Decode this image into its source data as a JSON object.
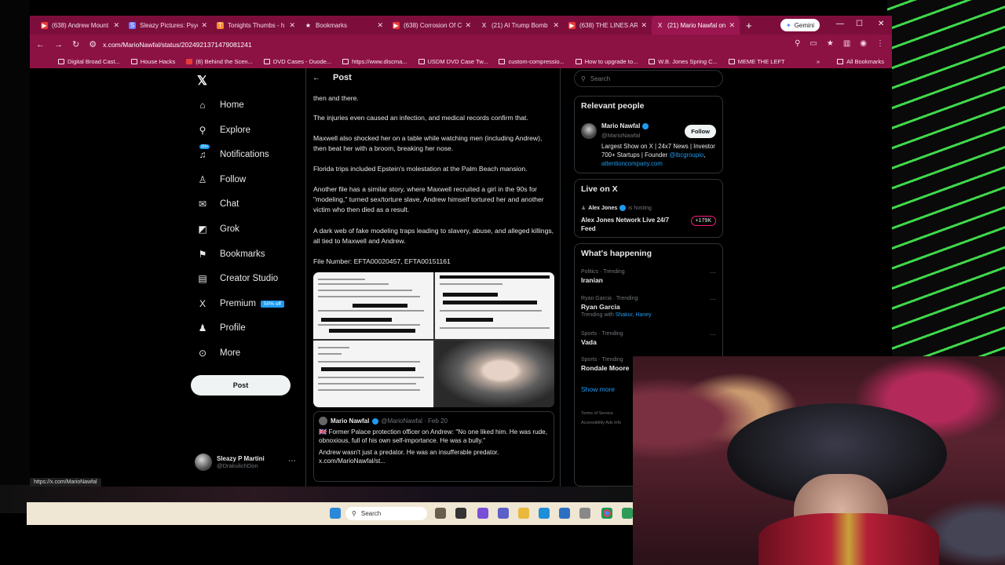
{
  "browser": {
    "tabs": [
      {
        "title": "(638) Andrew Mount",
        "icon_color": "#e83a3a"
      },
      {
        "title": "Sleazy Pictures: Psyc",
        "icon_color": "#6b7bff"
      },
      {
        "title": "Tonights Thumbs - h",
        "icon_color": "#ff8a2a"
      },
      {
        "title": "Bookmarks",
        "icon_color": "#ffffff"
      },
      {
        "title": "(638) Corrosion Of C",
        "icon_color": "#e83a3a"
      },
      {
        "title": "(21) AI Trump Bomb",
        "icon_color": "#111111"
      },
      {
        "title": "(638) THE LINES ARE",
        "icon_color": "#e83a3a"
      },
      {
        "title": "(21) Mario Nawfal on",
        "icon_color": "#111111",
        "active": true
      }
    ],
    "new_tab": "+",
    "gemini_label": "Gemini",
    "url": "x.com/MarioNawfal/status/2024921371479081241",
    "bookmarks": [
      "Digital Broad Cast...",
      "House Hacks",
      "(8) Behind the Scen...",
      "DVD Cases - Duode...",
      "https://www.discma...",
      "USDM DVD Case Tw...",
      "custom-compressio...",
      "How to upgrade to...",
      "W.B. Jones Spring C...",
      "MEME THE LEFT"
    ],
    "all_bookmarks": "All Bookmarks",
    "status_url": "https://x.com/MarioNawfal"
  },
  "nav": {
    "items": [
      {
        "label": "Home",
        "icon": "home-icon",
        "glyph": "⌂"
      },
      {
        "label": "Explore",
        "icon": "search-icon",
        "glyph": "⚲"
      },
      {
        "label": "Notifications",
        "icon": "bell-icon",
        "glyph": "♫",
        "badge": "20+"
      },
      {
        "label": "Follow",
        "icon": "follow-icon",
        "glyph": "♙"
      },
      {
        "label": "Chat",
        "icon": "chat-icon",
        "glyph": "✉"
      },
      {
        "label": "Grok",
        "icon": "grok-icon",
        "glyph": "◩"
      },
      {
        "label": "Bookmarks",
        "icon": "bookmark-icon",
        "glyph": "⚑"
      },
      {
        "label": "Creator Studio",
        "icon": "creator-icon",
        "glyph": "▤"
      },
      {
        "label": "Premium",
        "icon": "x-icon",
        "glyph": "X",
        "tag": "50% off"
      },
      {
        "label": "Profile",
        "icon": "profile-icon",
        "glyph": "♟"
      },
      {
        "label": "More",
        "icon": "more-icon",
        "glyph": "⊙"
      }
    ],
    "post_button": "Post",
    "account": {
      "name": "Sleazy P Martini",
      "handle": "@DrakulichDon"
    }
  },
  "post": {
    "header": "Post",
    "paragraphs": [
      "then and there.",
      "The injuries even caused an infection, and medical records confirm that.",
      "Maxwell also shocked her on a table while watching men (including Andrew), then beat her with a broom, breaking her nose.",
      "Florida trips included Epstein's molestation at the Palm Beach mansion.",
      "Another file has a similar story, where Maxwell recruited a girl in the  90s for \"modeling,\" turned sex/torture slave, Andrew himself tortured her and another victim who then died as a result.",
      "A dark web of fake modeling traps leading to slavery, abuse, and alleged killings, all tied to Maxwell and Andrew.",
      "File Number: EFTA00020457, EFTA00151161"
    ],
    "quote": {
      "name": "Mario Nawfal",
      "handle": "@MarioNawfal",
      "date": "Feb 20",
      "text1": "🇬🇧 Former Palace protection officer on Andrew: \"No one liked him. He was rude, obnoxious, full of his own self-importance. He was a bully.\"",
      "text2": "Andrew wasn't just a predator. He was an insufferable predator.",
      "link": "x.com/MarioNawfal/st..."
    }
  },
  "sidebar": {
    "search_placeholder": "Search",
    "relevant": {
      "title": "Relevant people",
      "name": "Mario Nawfal",
      "handle": "@MarioNawfal",
      "follow": "Follow",
      "bio": "Largest Show on X | 24x7 News | Investor 700+ Startups | Founder",
      "link1": "@ibcgroupio",
      "link_sep": ",",
      "link2": "attentioncompany.com"
    },
    "live": {
      "title": "Live on X",
      "host": "Alex Jones",
      "host_suffix": "is hosting",
      "stream_title": "Alex Jones Network Live 24/7 Feed",
      "count": "+179K"
    },
    "happening": {
      "title": "What's happening",
      "trends": [
        {
          "category": "Politics · Trending",
          "name": "Iranian"
        },
        {
          "category": "Ryan Garcia · Trending",
          "name": "Ryan Garcia",
          "with_prefix": "Trending with",
          "with_names": "Shakur, Haney"
        },
        {
          "category": "Sports · Trending",
          "name": "Vada"
        },
        {
          "category": "Sports · Trending",
          "name": "Rondale Moore"
        }
      ],
      "show_more": "Show more"
    },
    "footer": [
      "Terms of Service",
      "Accessibility",
      "Ads info"
    ]
  },
  "taskbar": {
    "search": "Search"
  }
}
